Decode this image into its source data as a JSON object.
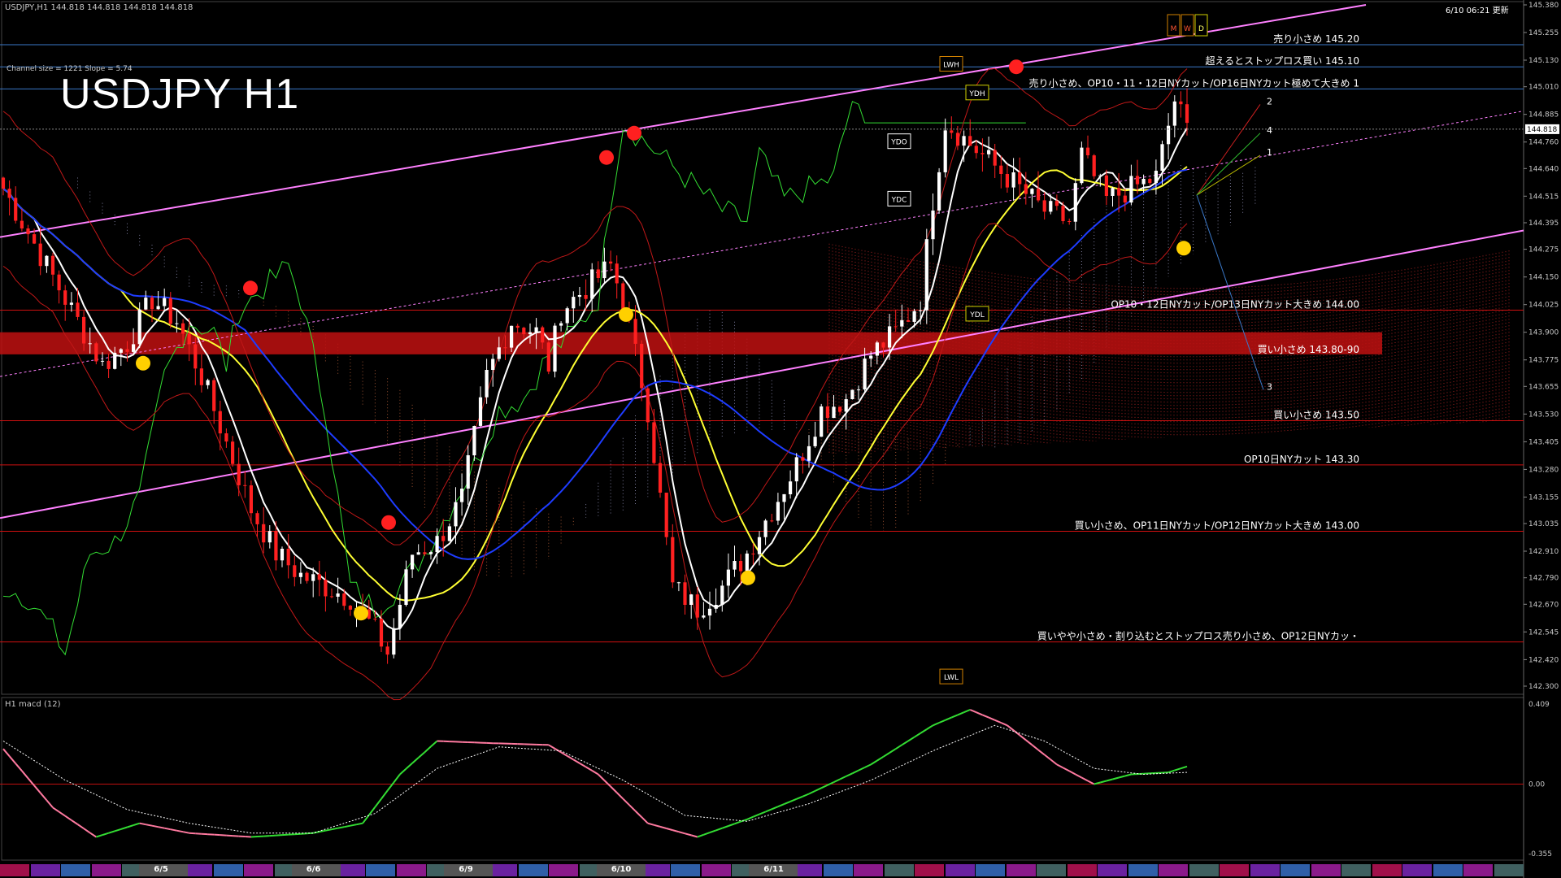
{
  "header": {
    "symbol_info": "USDJPY,H1  144.818 144.818 144.818 144.818",
    "channel_info": "Channel size = 1221 Slope = 5.74",
    "chart_title": "USDJPY H1",
    "updated": "6/10 06:21 更新"
  },
  "colors": {
    "background": "#000000",
    "bull": "#ffffff",
    "bear": "#ff2020",
    "level_blue": "#3a78c8",
    "level_red": "#d01010",
    "channel": "#ff80ff",
    "ma_white": "#ffffff",
    "ma_yellow": "#ffff33",
    "ma_blue": "#1e3cff",
    "span_green": "#33dd33",
    "macd_main": "#33dd33",
    "macd_signal": "#ffffff",
    "zone": "#c01010"
  },
  "chart_data": {
    "type": "candlestick",
    "title": "USDJPY H1",
    "ylim": [
      142.3,
      145.38
    ],
    "y_ticks": [
      "145.380",
      "145.255",
      "145.130",
      "145.010",
      "144.885",
      "144.760",
      "144.640",
      "144.515",
      "144.395",
      "144.275",
      "144.150",
      "144.025",
      "143.900",
      "143.775",
      "143.655",
      "143.530",
      "143.405",
      "143.280",
      "143.155",
      "143.035",
      "142.910",
      "142.790",
      "142.670",
      "142.545",
      "142.420",
      "142.300"
    ],
    "current_price": "144.818",
    "x_labels": [
      {
        "label": "6/5",
        "frac": 0.07
      },
      {
        "label": "6/6",
        "frac": 0.17
      },
      {
        "label": "6/9",
        "frac": 0.27
      },
      {
        "label": "6/10",
        "frac": 0.37
      },
      {
        "label": "6/11",
        "frac": 0.47
      }
    ],
    "close_path": [
      [
        0,
        144.55
      ],
      [
        4,
        144.35
      ],
      [
        8,
        144.15
      ],
      [
        12,
        143.95
      ],
      [
        16,
        143.75
      ],
      [
        20,
        143.85
      ],
      [
        24,
        144.05
      ],
      [
        28,
        143.95
      ],
      [
        32,
        143.7
      ],
      [
        36,
        143.4
      ],
      [
        40,
        143.1
      ],
      [
        44,
        142.9
      ],
      [
        48,
        142.8
      ],
      [
        52,
        142.75
      ],
      [
        56,
        142.7
      ],
      [
        60,
        142.55
      ],
      [
        62,
        142.45
      ],
      [
        66,
        142.9
      ],
      [
        70,
        142.95
      ],
      [
        74,
        143.15
      ],
      [
        78,
        143.7
      ],
      [
        82,
        143.95
      ],
      [
        86,
        143.9
      ],
      [
        88,
        143.75
      ],
      [
        90,
        144.0
      ],
      [
        94,
        144.1
      ],
      [
        98,
        144.2
      ],
      [
        100,
        144.05
      ],
      [
        104,
        143.55
      ],
      [
        108,
        142.75
      ],
      [
        112,
        142.65
      ],
      [
        116,
        142.75
      ],
      [
        120,
        142.9
      ],
      [
        124,
        143.1
      ],
      [
        128,
        143.3
      ],
      [
        132,
        143.55
      ],
      [
        136,
        143.6
      ],
      [
        140,
        143.8
      ],
      [
        144,
        143.9
      ],
      [
        148,
        144.05
      ],
      [
        150,
        144.5
      ],
      [
        152,
        144.85
      ],
      [
        156,
        144.75
      ],
      [
        160,
        144.65
      ],
      [
        164,
        144.55
      ],
      [
        168,
        144.45
      ],
      [
        172,
        144.4
      ],
      [
        174,
        144.7
      ],
      [
        178,
        144.5
      ],
      [
        182,
        144.55
      ],
      [
        186,
        144.6
      ],
      [
        189,
        144.95
      ],
      [
        191,
        144.82
      ]
    ],
    "levels": [
      {
        "price": 145.2,
        "label": "売り小さめ 145.20",
        "color": "#3a78c8"
      },
      {
        "price": 145.1,
        "label": "超えるとストップロス買い 145.10",
        "color": "#3a78c8"
      },
      {
        "price": 145.0,
        "label": "売り小さめ、OP10・11・12日NYカット/OP16日NYカット極めて大きめ 1",
        "color": "#3a78c8"
      },
      {
        "price": 144.0,
        "label": "OP10・12日NYカット/OP13日NYカット大きめ 144.00",
        "color": "#d01010"
      },
      {
        "price": 143.5,
        "label": "買い小さめ 143.50",
        "color": "#d01010"
      },
      {
        "price": 143.3,
        "label": "OP10日NYカット 143.30",
        "color": "#d01010"
      },
      {
        "price": 143.0,
        "label": "買い小さめ、OP11日NYカット/OP12日NYカット大きめ 143.00",
        "color": "#d01010"
      },
      {
        "price": 142.5,
        "label": "買いやや小さめ・割り込むとストップロス売り小さめ、OP12日NYカッ・",
        "color": "#d01010"
      }
    ],
    "zone": {
      "from": 143.8,
      "to": 143.9,
      "label": "買い小さめ 143.80-90"
    },
    "boxes": [
      "LWH",
      "YDH",
      "YDO",
      "YDC",
      "YDL",
      "LWL"
    ],
    "mwd_top": [
      "M",
      "W",
      "D"
    ],
    "projection_labels": [
      "1",
      "2",
      "3",
      "4"
    ],
    "macd": {
      "title": "H1  macd (12)",
      "ylim": [
        -0.355,
        0.409
      ],
      "y_ticks": [
        "0.409",
        "0.00",
        "-0.355"
      ],
      "main": [
        [
          0,
          0.18
        ],
        [
          8,
          -0.12
        ],
        [
          15,
          -0.27
        ],
        [
          22,
          -0.2
        ],
        [
          30,
          -0.25
        ],
        [
          40,
          -0.27
        ],
        [
          50,
          -0.25
        ],
        [
          58,
          -0.2
        ],
        [
          64,
          0.05
        ],
        [
          70,
          0.22
        ],
        [
          78,
          0.21
        ],
        [
          88,
          0.2
        ],
        [
          96,
          0.05
        ],
        [
          104,
          -0.2
        ],
        [
          112,
          -0.27
        ],
        [
          120,
          -0.18
        ],
        [
          130,
          -0.05
        ],
        [
          140,
          0.1
        ],
        [
          150,
          0.3
        ],
        [
          156,
          0.38
        ],
        [
          162,
          0.3
        ],
        [
          170,
          0.1
        ],
        [
          176,
          0.0
        ],
        [
          182,
          0.05
        ],
        [
          188,
          0.06
        ],
        [
          191,
          0.09
        ]
      ],
      "signal": [
        [
          0,
          0.22
        ],
        [
          10,
          0.02
        ],
        [
          20,
          -0.13
        ],
        [
          30,
          -0.2
        ],
        [
          40,
          -0.25
        ],
        [
          50,
          -0.25
        ],
        [
          60,
          -0.15
        ],
        [
          70,
          0.08
        ],
        [
          80,
          0.19
        ],
        [
          90,
          0.17
        ],
        [
          100,
          0.02
        ],
        [
          110,
          -0.16
        ],
        [
          120,
          -0.19
        ],
        [
          130,
          -0.1
        ],
        [
          140,
          0.02
        ],
        [
          150,
          0.17
        ],
        [
          160,
          0.3
        ],
        [
          168,
          0.22
        ],
        [
          176,
          0.08
        ],
        [
          184,
          0.05
        ],
        [
          191,
          0.06
        ]
      ]
    }
  }
}
